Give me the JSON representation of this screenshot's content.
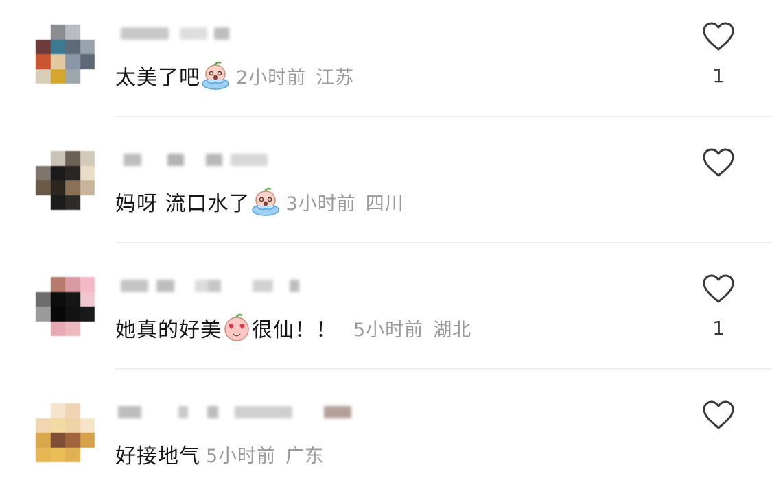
{
  "comments": [
    {
      "text_before": "太美了吧",
      "emoji": "crying-peach-emoji",
      "text_after": "",
      "time": "2小时前",
      "location": "江苏",
      "likes": "1",
      "liked": false
    },
    {
      "text_before": "妈呀 流口水了",
      "emoji": "crying-peach-emoji",
      "text_after": "",
      "time": "3小时前",
      "location": "四川",
      "likes": "",
      "liked": false
    },
    {
      "text_before": "她真的好美",
      "emoji": "heart-eyes-peach-emoji",
      "text_after": "很仙！！",
      "time": "5小时前",
      "location": "湖北",
      "likes": "1",
      "liked": false
    },
    {
      "text_before": "好接地气",
      "emoji": "",
      "text_after": "",
      "time": "5小时前",
      "location": "广东",
      "likes": "",
      "liked": false
    }
  ],
  "colors": {
    "text": "#161616",
    "meta": "#9b9b9b",
    "divider": "#ebebeb",
    "icon": "#3a3a3a"
  }
}
